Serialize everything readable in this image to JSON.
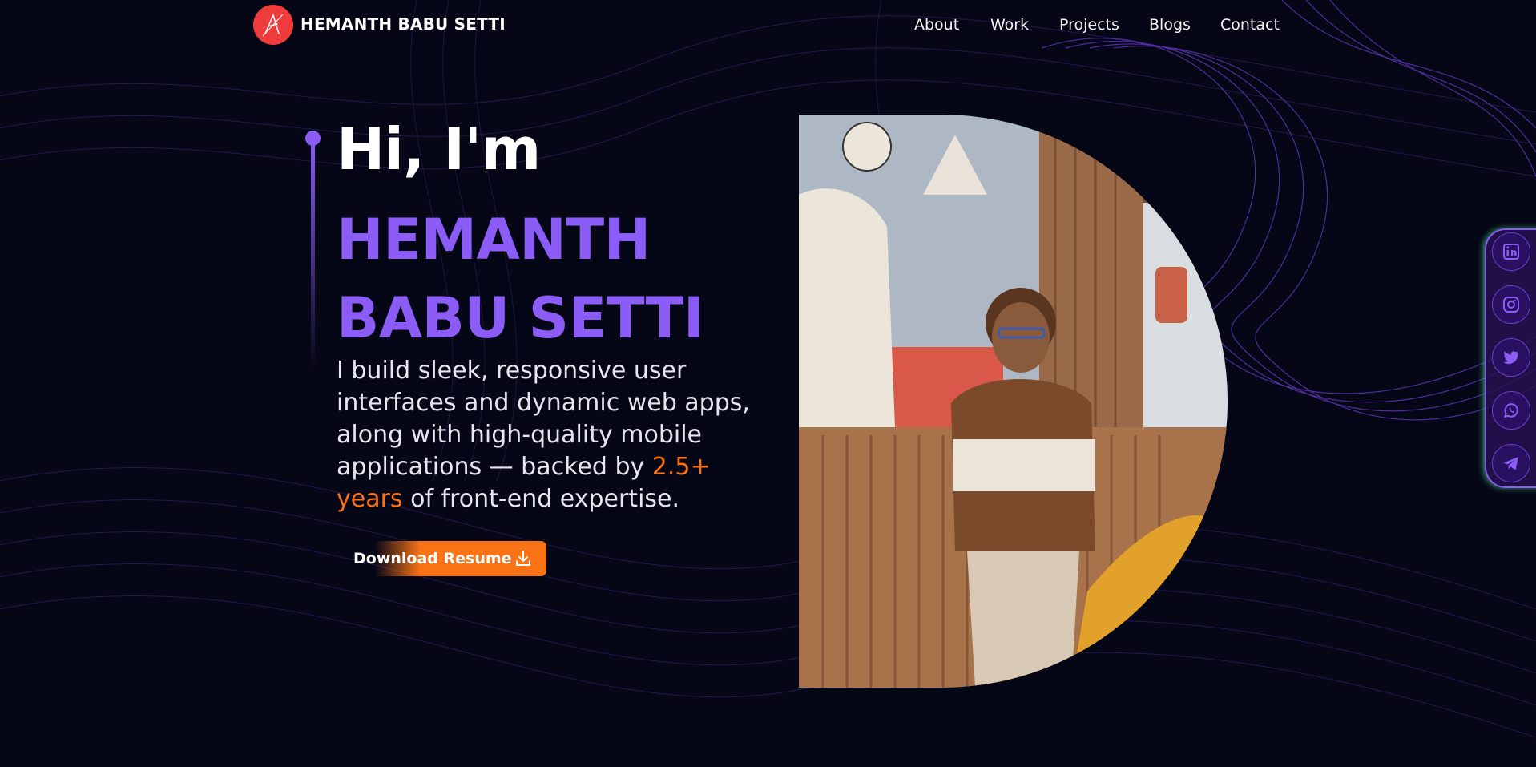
{
  "header": {
    "brand": "HEMANTH BABU SETTI",
    "logo_icon": "signature-logo-icon",
    "nav": [
      "About",
      "Work",
      "Projects",
      "Blogs",
      "Contact"
    ]
  },
  "hero": {
    "greeting": "Hi, I'm",
    "name_line1": "HEMANTH",
    "name_line2": "BABU SETTI",
    "description_prefix": "I build sleek, responsive user interfaces and dynamic web apps, along with high-quality mobile applications — backed by ",
    "description_highlight": "2.5+ years",
    "description_suffix": " of front-end expertise.",
    "button_label": "Download Resume",
    "button_icon": "download-icon"
  },
  "social": [
    {
      "icon": "linkedin-icon"
    },
    {
      "icon": "instagram-icon"
    },
    {
      "icon": "twitter-icon"
    },
    {
      "icon": "whatsapp-icon"
    },
    {
      "icon": "telegram-icon"
    }
  ],
  "colors": {
    "background": "#050616",
    "accent_purple": "#8b5cf6",
    "accent_orange": "#f97316",
    "logo_red": "#ef3b3b",
    "social_glow": "#48dc8c"
  }
}
